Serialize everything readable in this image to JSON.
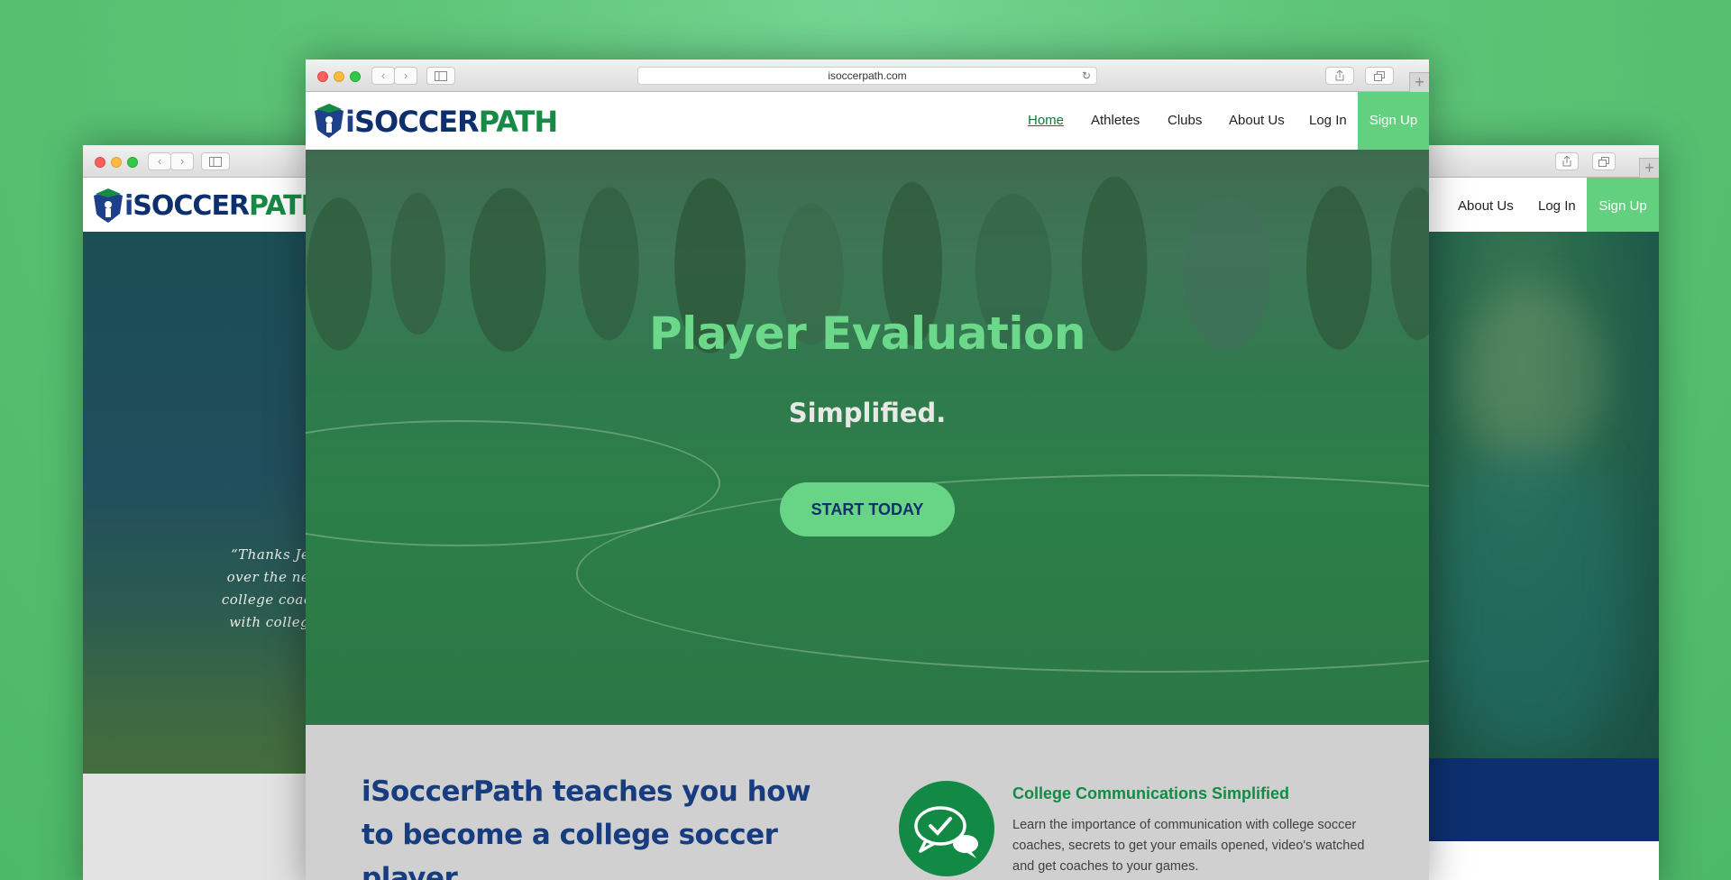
{
  "brand": {
    "logo_i": "i",
    "logo_soccer": "SOCCER",
    "logo_path": "PATH",
    "accent_color": "#63d07f",
    "navy_color": "#173c7f",
    "green_color": "#138a45"
  },
  "front_window": {
    "url": "isoccerpath.com",
    "nav": {
      "home": "Home",
      "athletes": "Athletes",
      "clubs": "Clubs",
      "about": "About Us",
      "login": "Log In",
      "signup": "Sign Up"
    },
    "hero": {
      "title": "Player Evaluation",
      "subtitle": "Simplified.",
      "cta": "START TODAY"
    },
    "intro": {
      "heading": "iSoccerPath teaches you how to become a college soccer player.",
      "feature_title": "College Communications Simplified",
      "feature_desc": "Learn the importance of communication with college soccer coaches, secrets to get your emails opened, video's watched and get coaches to your games."
    }
  },
  "left_window": {
    "quote_lines": [
      "“Thanks Jeff for",
      "over the next fev",
      "college coaches, h",
      "with college coa"
    ]
  },
  "right_window": {
    "nav": {
      "about": "About Us",
      "login": "Log In",
      "signup": "Sign Up"
    }
  },
  "icons": {
    "share": "share-icon",
    "tabs": "tabs-icon",
    "sidebar": "sidebar-icon",
    "back": "chevron-left-icon",
    "forward": "chevron-right-icon",
    "reload": "reload-icon",
    "new_tab": "plus-icon",
    "chat": "chat-check-icon"
  }
}
